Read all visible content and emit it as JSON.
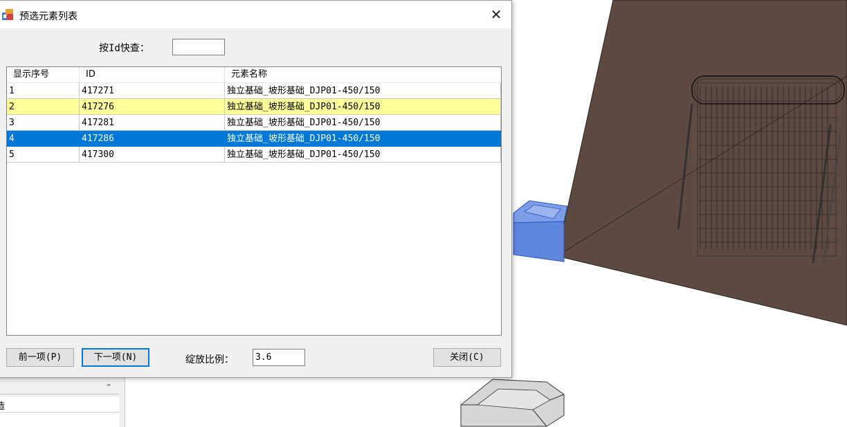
{
  "dialog": {
    "title": "预选元素列表",
    "close_glyph": "✕",
    "search_label": "按Id快查：",
    "search_value": "",
    "columns": [
      "显示序号",
      "ID",
      "元素名称"
    ],
    "rows": [
      {
        "index": "1",
        "id": "417271",
        "name": "独立基础_坡形基础_DJP01-450/150",
        "state": "normal"
      },
      {
        "index": "2",
        "id": "417276",
        "name": "独立基础_坡形基础_DJP01-450/150",
        "state": "highlighted"
      },
      {
        "index": "3",
        "id": "417281",
        "name": "独立基础_坡形基础_DJP01-450/150",
        "state": "normal"
      },
      {
        "index": "4",
        "id": "417286",
        "name": "独立基础_坡形基础_DJP01-450/150",
        "state": "selected"
      },
      {
        "index": "5",
        "id": "417300",
        "name": "独立基础_坡形基础_DJP01-450/150",
        "state": "normal"
      }
    ],
    "prev_label": "前一项(P)",
    "next_label": "下一项(N)",
    "zoom_label": "绽放比例：",
    "zoom_value": "3.6",
    "close_label": "关闭(C)"
  },
  "background_panel": {
    "chevron": "⌃",
    "row_text": "造"
  },
  "colors": {
    "highlight_row": "#ffff99",
    "selected_row": "#0078d7",
    "wall": "#5d4a41",
    "foundation_blue": "#6b8fe0"
  }
}
